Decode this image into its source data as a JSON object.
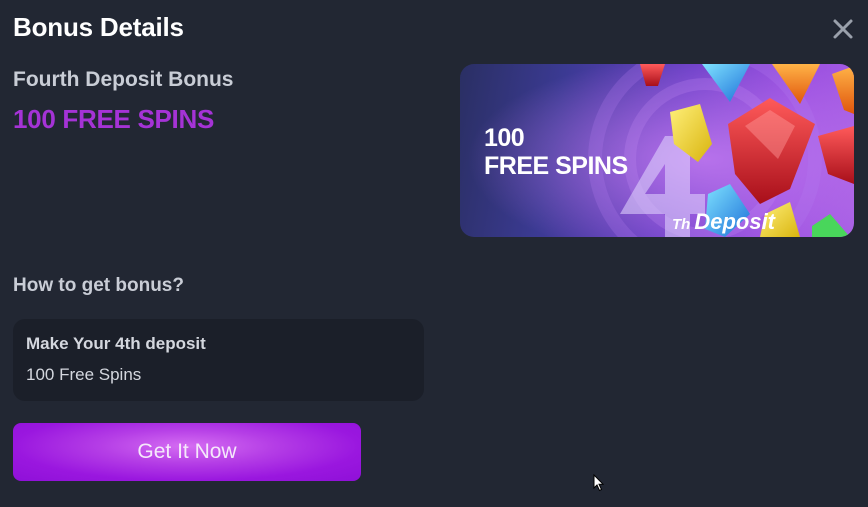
{
  "modal": {
    "title": "Bonus Details",
    "close_icon": "close-icon"
  },
  "bonus": {
    "name": "Fourth Deposit Bonus",
    "amount": "100 FREE SPINS",
    "amount_color": "#a533d6"
  },
  "banner": {
    "line1": "100",
    "line2": "FREE SPINS",
    "big_number": "4",
    "suffix": "Th",
    "deposit_label": "Deposit"
  },
  "how_to": {
    "title": "How to get bonus?",
    "step_title": "Make Your 4th deposit",
    "step_description": "100 Free Spins"
  },
  "cta": {
    "label": "Get It Now",
    "color": "#9a17df"
  },
  "colors": {
    "background": "#222733",
    "card": "#1b1f29",
    "accent": "#a533d6"
  }
}
